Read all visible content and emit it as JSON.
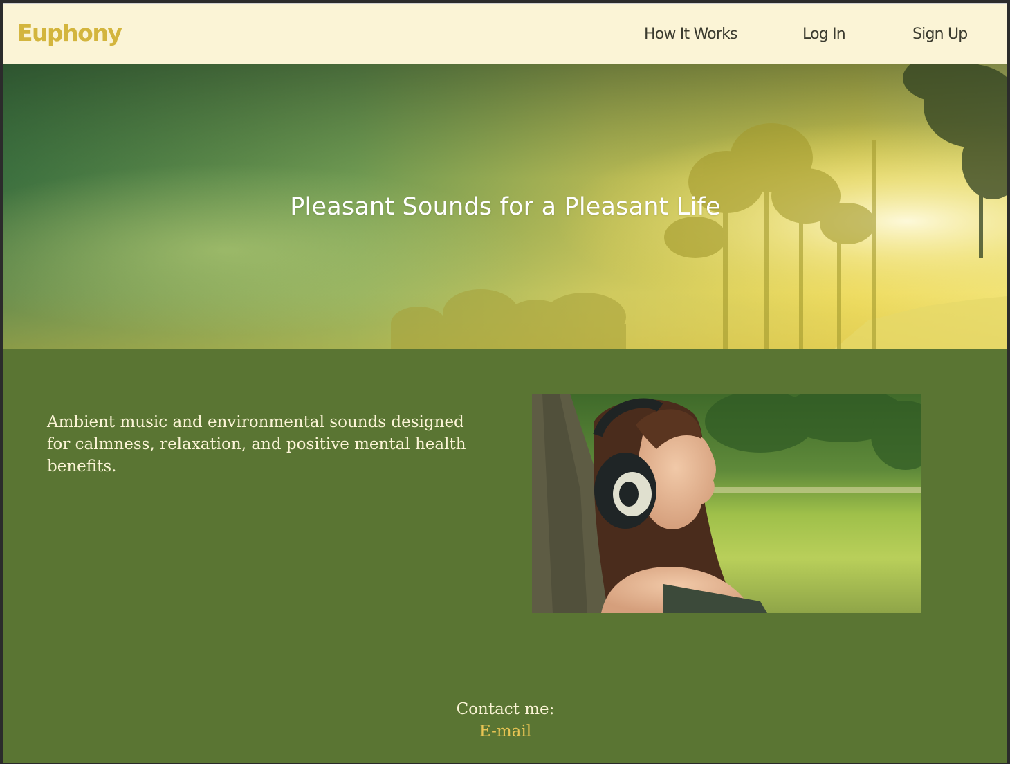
{
  "navbar": {
    "brand": "Euphony",
    "links": [
      {
        "label": "How It Works"
      },
      {
        "label": "Log In"
      },
      {
        "label": "Sign Up"
      }
    ]
  },
  "hero": {
    "title": "Pleasant Sounds for a Pleasant Life"
  },
  "main": {
    "description": "Ambient music and environmental sounds designed for calmness, relaxation, and positive mental health benefits."
  },
  "footer": {
    "contact_label": "Contact me:",
    "email_label": "E-mail"
  },
  "colors": {
    "nav_bg": "#fbf4d6",
    "brand": "#d3b53e",
    "main_bg": "#5a7533",
    "text_light": "#fbf4d6",
    "link_gold": "#e8c454"
  }
}
